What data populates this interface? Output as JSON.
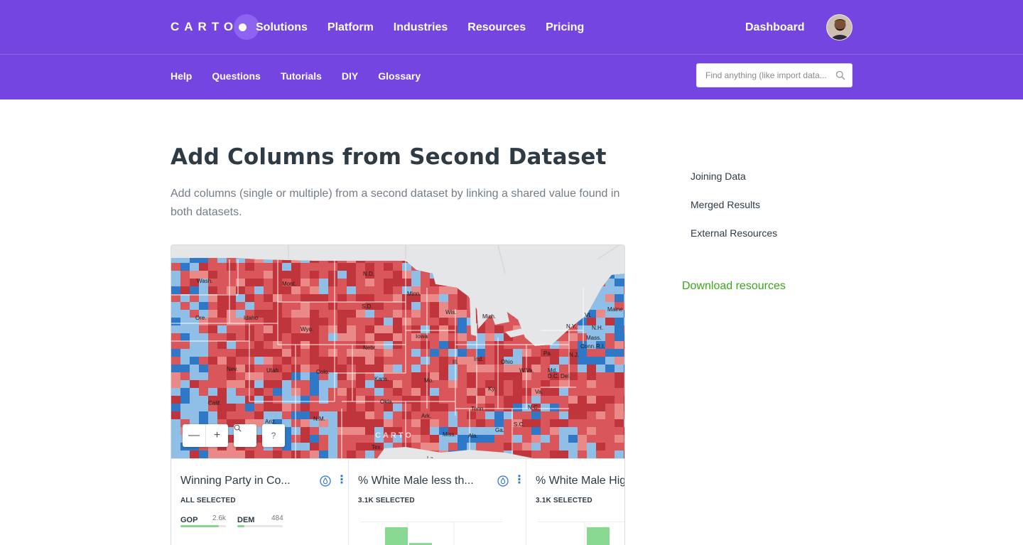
{
  "nav": {
    "logo": "CARTO",
    "items": [
      {
        "label": "Solutions"
      },
      {
        "label": "Platform"
      },
      {
        "label": "Industries"
      },
      {
        "label": "Resources"
      },
      {
        "label": "Pricing"
      }
    ],
    "dashboard": "Dashboard",
    "avatar_icon": "user-avatar"
  },
  "subnav": {
    "items": [
      {
        "label": "Help"
      },
      {
        "label": "Questions"
      },
      {
        "label": "Tutorials"
      },
      {
        "label": "DIY"
      },
      {
        "label": "Glossary"
      }
    ],
    "search_placeholder": "Find anything (like import data...",
    "search_icon": "search-icon"
  },
  "page": {
    "title": "Add Columns from Second Dataset",
    "subtitle": "Add columns (single or multiple) from a second dataset by linking a shared value found in both datasets."
  },
  "toc": {
    "items": [
      {
        "label": "Joining Data"
      },
      {
        "label": "Merged Results"
      },
      {
        "label": "External Resources"
      }
    ],
    "download": "Download resources"
  },
  "map": {
    "watermark": "CARTO",
    "state_labels": [
      "Wash.",
      "Mont.",
      "N.D.",
      "Minn.",
      "Ore.",
      "Idaho",
      "S.D.",
      "Wis.",
      "Mich.",
      "Wyo.",
      "Iowa",
      "Nebr.",
      "Ill.",
      "Ind.",
      "Ohio",
      "Nev.",
      "Utah",
      "Colo.",
      "Kans.",
      "Mo.",
      "W.Va.",
      "Calif.",
      "Okla.",
      "Ky.",
      "Va.",
      "Ariz.",
      "N.M.",
      "Ark.",
      "Tenn.",
      "N.C.",
      "Miss.",
      "Ala.",
      "Ga.",
      "S.C.",
      "Tex.",
      "La.",
      "Pa.",
      "N.Y.",
      "Vt.",
      "N.H.",
      "Maine",
      "Mass.",
      "Conn.",
      "R.I.",
      "N.J.",
      "Md.",
      "Del.",
      "D.C."
    ],
    "controls": {
      "zoom_out": "—",
      "zoom_in": "+",
      "search": "search-icon",
      "help": "?"
    },
    "colors": {
      "gop_strong": "#c0353b",
      "gop": "#d9575a",
      "gop_light": "#e98a88",
      "dem": "#2f78c8",
      "dem_light": "#8fbfe6",
      "land": "#e4e6e7"
    }
  },
  "widgets": [
    {
      "title": "Winning Party in Co...",
      "selected": "ALL SELECTED",
      "categories": [
        {
          "name": "GOP",
          "count": "2.6k",
          "fraction": 0.84
        },
        {
          "name": "DEM",
          "count": "484",
          "fraction": 0.16
        }
      ]
    },
    {
      "title": "% White Male less th...",
      "selected": "3.1K SELECTED",
      "histogram": [
        0,
        1,
        0.35,
        0,
        0,
        0
      ]
    },
    {
      "title": "% White Male Hig",
      "selected": "3.1K SELECTED",
      "histogram": [
        0,
        0.15,
        1,
        0,
        0
      ]
    }
  ],
  "accent": "#7445e0",
  "link_green": "#3aa71a"
}
